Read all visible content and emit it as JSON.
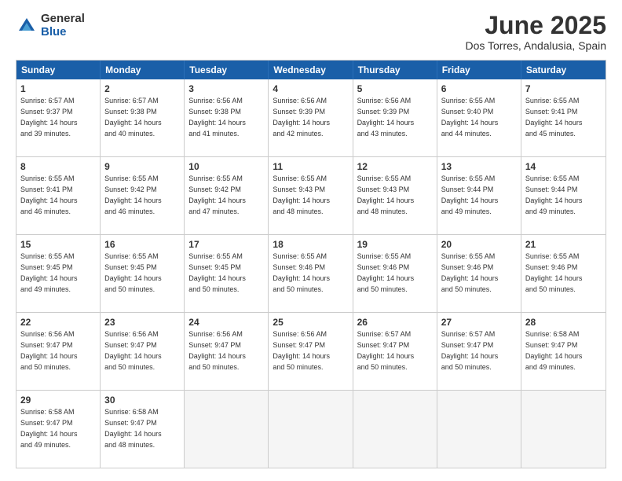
{
  "logo": {
    "general": "General",
    "blue": "Blue"
  },
  "title": "June 2025",
  "subtitle": "Dos Torres, Andalusia, Spain",
  "headers": [
    "Sunday",
    "Monday",
    "Tuesday",
    "Wednesday",
    "Thursday",
    "Friday",
    "Saturday"
  ],
  "rows": [
    [
      {
        "day": "1",
        "info": "Sunrise: 6:57 AM\nSunset: 9:37 PM\nDaylight: 14 hours\nand 39 minutes."
      },
      {
        "day": "2",
        "info": "Sunrise: 6:57 AM\nSunset: 9:38 PM\nDaylight: 14 hours\nand 40 minutes."
      },
      {
        "day": "3",
        "info": "Sunrise: 6:56 AM\nSunset: 9:38 PM\nDaylight: 14 hours\nand 41 minutes."
      },
      {
        "day": "4",
        "info": "Sunrise: 6:56 AM\nSunset: 9:39 PM\nDaylight: 14 hours\nand 42 minutes."
      },
      {
        "day": "5",
        "info": "Sunrise: 6:56 AM\nSunset: 9:39 PM\nDaylight: 14 hours\nand 43 minutes."
      },
      {
        "day": "6",
        "info": "Sunrise: 6:55 AM\nSunset: 9:40 PM\nDaylight: 14 hours\nand 44 minutes."
      },
      {
        "day": "7",
        "info": "Sunrise: 6:55 AM\nSunset: 9:41 PM\nDaylight: 14 hours\nand 45 minutes."
      }
    ],
    [
      {
        "day": "8",
        "info": "Sunrise: 6:55 AM\nSunset: 9:41 PM\nDaylight: 14 hours\nand 46 minutes."
      },
      {
        "day": "9",
        "info": "Sunrise: 6:55 AM\nSunset: 9:42 PM\nDaylight: 14 hours\nand 46 minutes."
      },
      {
        "day": "10",
        "info": "Sunrise: 6:55 AM\nSunset: 9:42 PM\nDaylight: 14 hours\nand 47 minutes."
      },
      {
        "day": "11",
        "info": "Sunrise: 6:55 AM\nSunset: 9:43 PM\nDaylight: 14 hours\nand 48 minutes."
      },
      {
        "day": "12",
        "info": "Sunrise: 6:55 AM\nSunset: 9:43 PM\nDaylight: 14 hours\nand 48 minutes."
      },
      {
        "day": "13",
        "info": "Sunrise: 6:55 AM\nSunset: 9:44 PM\nDaylight: 14 hours\nand 49 minutes."
      },
      {
        "day": "14",
        "info": "Sunrise: 6:55 AM\nSunset: 9:44 PM\nDaylight: 14 hours\nand 49 minutes."
      }
    ],
    [
      {
        "day": "15",
        "info": "Sunrise: 6:55 AM\nSunset: 9:45 PM\nDaylight: 14 hours\nand 49 minutes."
      },
      {
        "day": "16",
        "info": "Sunrise: 6:55 AM\nSunset: 9:45 PM\nDaylight: 14 hours\nand 50 minutes."
      },
      {
        "day": "17",
        "info": "Sunrise: 6:55 AM\nSunset: 9:45 PM\nDaylight: 14 hours\nand 50 minutes."
      },
      {
        "day": "18",
        "info": "Sunrise: 6:55 AM\nSunset: 9:46 PM\nDaylight: 14 hours\nand 50 minutes."
      },
      {
        "day": "19",
        "info": "Sunrise: 6:55 AM\nSunset: 9:46 PM\nDaylight: 14 hours\nand 50 minutes."
      },
      {
        "day": "20",
        "info": "Sunrise: 6:55 AM\nSunset: 9:46 PM\nDaylight: 14 hours\nand 50 minutes."
      },
      {
        "day": "21",
        "info": "Sunrise: 6:55 AM\nSunset: 9:46 PM\nDaylight: 14 hours\nand 50 minutes."
      }
    ],
    [
      {
        "day": "22",
        "info": "Sunrise: 6:56 AM\nSunset: 9:47 PM\nDaylight: 14 hours\nand 50 minutes."
      },
      {
        "day": "23",
        "info": "Sunrise: 6:56 AM\nSunset: 9:47 PM\nDaylight: 14 hours\nand 50 minutes."
      },
      {
        "day": "24",
        "info": "Sunrise: 6:56 AM\nSunset: 9:47 PM\nDaylight: 14 hours\nand 50 minutes."
      },
      {
        "day": "25",
        "info": "Sunrise: 6:56 AM\nSunset: 9:47 PM\nDaylight: 14 hours\nand 50 minutes."
      },
      {
        "day": "26",
        "info": "Sunrise: 6:57 AM\nSunset: 9:47 PM\nDaylight: 14 hours\nand 50 minutes."
      },
      {
        "day": "27",
        "info": "Sunrise: 6:57 AM\nSunset: 9:47 PM\nDaylight: 14 hours\nand 50 minutes."
      },
      {
        "day": "28",
        "info": "Sunrise: 6:58 AM\nSunset: 9:47 PM\nDaylight: 14 hours\nand 49 minutes."
      }
    ],
    [
      {
        "day": "29",
        "info": "Sunrise: 6:58 AM\nSunset: 9:47 PM\nDaylight: 14 hours\nand 49 minutes."
      },
      {
        "day": "30",
        "info": "Sunrise: 6:58 AM\nSunset: 9:47 PM\nDaylight: 14 hours\nand 48 minutes."
      },
      {
        "day": "",
        "info": ""
      },
      {
        "day": "",
        "info": ""
      },
      {
        "day": "",
        "info": ""
      },
      {
        "day": "",
        "info": ""
      },
      {
        "day": "",
        "info": ""
      }
    ]
  ]
}
